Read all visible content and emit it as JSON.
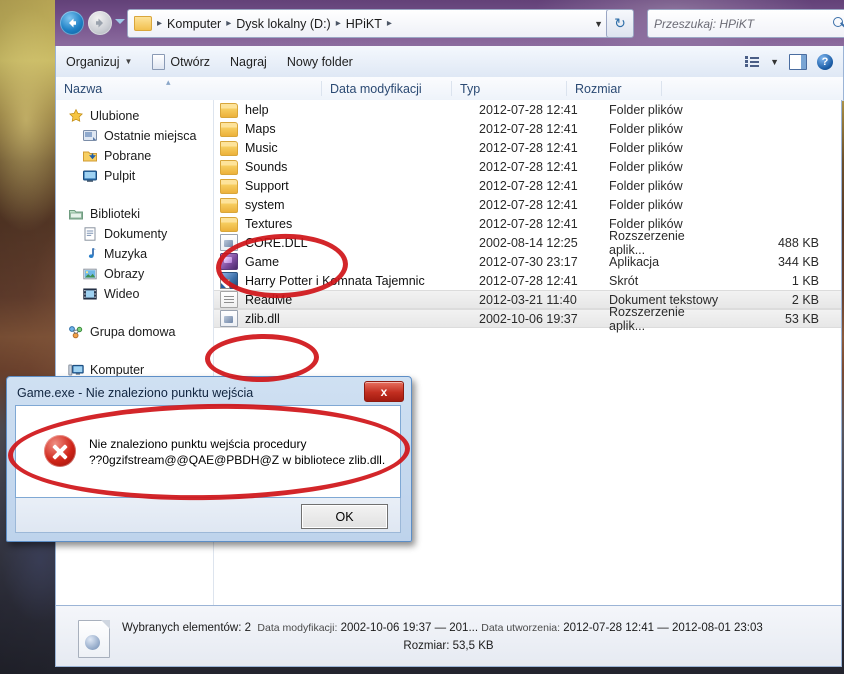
{
  "window": {
    "nav": {
      "back_label": "Wstecz",
      "forward_label": "Dalej",
      "recent_dropdown_label": "Ostatnie lokalizacje"
    },
    "address": {
      "crumbs": [
        "Komputer",
        "Dysk lokalny (D:)",
        "HPiKT"
      ],
      "separator": "▸",
      "dropdown_caret": "▼",
      "refresh_glyph": "↻"
    },
    "search": {
      "placeholder": "Przeszukaj: HPiKT",
      "icon": "search-icon"
    },
    "commandbar": {
      "organize": "Organizuj",
      "organize_caret": "▼",
      "open": "Otwórz",
      "burn": "Nagraj",
      "new_folder": "Nowy folder",
      "view_caret": "▼",
      "help_glyph": "?"
    },
    "columns": [
      {
        "key": "name",
        "label": "Nazwa"
      },
      {
        "key": "date",
        "label": "Data modyfikacji"
      },
      {
        "key": "type",
        "label": "Typ"
      },
      {
        "key": "size",
        "label": "Rozmiar"
      }
    ],
    "sort_marker": "▴"
  },
  "sidebar": {
    "groups": [
      {
        "header": {
          "label": "Ulubione",
          "icon": "star-icon"
        },
        "items": [
          {
            "label": "Ostatnie miejsca",
            "icon": "recent-places-icon"
          },
          {
            "label": "Pobrane",
            "icon": "downloads-icon"
          },
          {
            "label": "Pulpit",
            "icon": "desktop-icon"
          }
        ]
      },
      {
        "header": {
          "label": "Biblioteki",
          "icon": "libraries-icon"
        },
        "items": [
          {
            "label": "Dokumenty",
            "icon": "documents-icon"
          },
          {
            "label": "Muzyka",
            "icon": "music-icon"
          },
          {
            "label": "Obrazy",
            "icon": "pictures-icon"
          },
          {
            "label": "Wideo",
            "icon": "video-icon"
          }
        ]
      },
      {
        "header": {
          "label": "Grupa domowa",
          "icon": "homegroup-icon"
        },
        "items": []
      },
      {
        "header": {
          "label": "Komputer",
          "icon": "computer-icon"
        },
        "items": []
      }
    ]
  },
  "files": [
    {
      "name": "help",
      "icon": "folder-icon",
      "date": "2012-07-28 12:41",
      "type": "Folder plików",
      "size": "",
      "selected": false
    },
    {
      "name": "Maps",
      "icon": "folder-icon",
      "date": "2012-07-28 12:41",
      "type": "Folder plików",
      "size": "",
      "selected": false
    },
    {
      "name": "Music",
      "icon": "folder-icon",
      "date": "2012-07-28 12:41",
      "type": "Folder plików",
      "size": "",
      "selected": false
    },
    {
      "name": "Sounds",
      "icon": "folder-icon",
      "date": "2012-07-28 12:41",
      "type": "Folder plików",
      "size": "",
      "selected": false
    },
    {
      "name": "Support",
      "icon": "folder-icon",
      "date": "2012-07-28 12:41",
      "type": "Folder plików",
      "size": "",
      "selected": false
    },
    {
      "name": "system",
      "icon": "folder-icon",
      "date": "2012-07-28 12:41",
      "type": "Folder plików",
      "size": "",
      "selected": false
    },
    {
      "name": "Textures",
      "icon": "folder-icon",
      "date": "2012-07-28 12:41",
      "type": "Folder plików",
      "size": "",
      "selected": false
    },
    {
      "name": "CORE.DLL",
      "icon": "dll-icon",
      "date": "2002-08-14 12:25",
      "type": "Rozszerzenie aplik...",
      "size": "488 KB",
      "selected": false
    },
    {
      "name": "Game",
      "icon": "application-icon",
      "date": "2012-07-30 23:17",
      "type": "Aplikacja",
      "size": "344 KB",
      "selected": false
    },
    {
      "name": "Harry Potter i Komnata Tajemnic",
      "icon": "shortcut-icon",
      "date": "2012-07-28 12:41",
      "type": "Skrót",
      "size": "1 KB",
      "selected": false
    },
    {
      "name": "ReadMe",
      "icon": "text-file-icon",
      "date": "2012-03-21 11:40",
      "type": "Dokument tekstowy",
      "size": "2 KB",
      "selected": true
    },
    {
      "name": "zlib.dll",
      "icon": "dll-icon",
      "date": "2002-10-06 19:37",
      "type": "Rozszerzenie aplik...",
      "size": "53 KB",
      "selected": true
    }
  ],
  "statusbar": {
    "selected_label": "Wybranych elementów:",
    "selected_count": "2",
    "modified_label": "Data modyfikacji:",
    "modified_value": "2002-10-06 19:37 — 201...",
    "created_label": "Data utworzenia:",
    "created_value": "2012-07-28 12:41 — 2012-08-01 23:03",
    "size_label": "Rozmiar:",
    "size_value": "53,5 KB"
  },
  "dialog": {
    "title": "Game.exe - Nie znaleziono punktu wejścia",
    "close_glyph": "x",
    "message_line1": "Nie znaleziono punktu wejścia procedury",
    "message_line2": "??0gzifstream@@QAE@PBDH@Z w bibliotece zlib.dll.",
    "ok_label": "OK",
    "error_icon": "error-cross-icon"
  },
  "annotations": {
    "marker_color": "#cf1418",
    "circles": [
      {
        "name": "circle-core-dll",
        "target": "CORE.DLL / Textures rows"
      },
      {
        "name": "circle-zlib-dll",
        "target": "zlib.dll row"
      },
      {
        "name": "circle-dialog-message",
        "target": "error dialog message"
      }
    ]
  }
}
